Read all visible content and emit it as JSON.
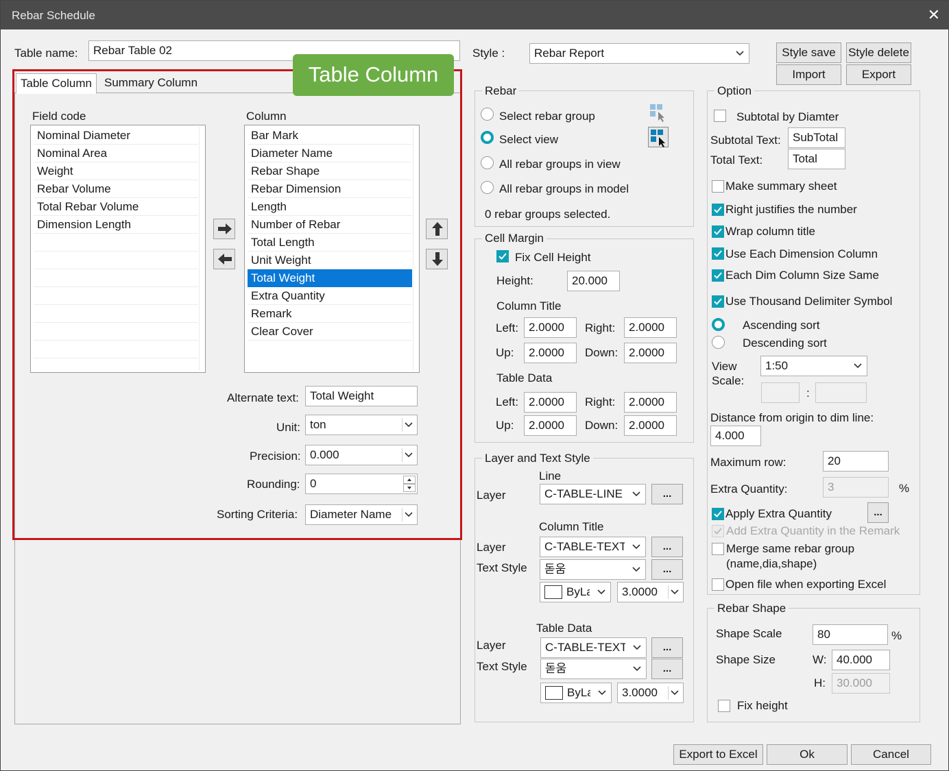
{
  "window": {
    "title": "Rebar Schedule"
  },
  "table_name": {
    "label": "Table name:",
    "value": "Rebar Table 02"
  },
  "callout": "Table Column",
  "tabs": [
    "Table Column",
    "Summary Column"
  ],
  "field_code": {
    "label": "Field code",
    "items": [
      "Nominal Diameter",
      "Nominal Area",
      "Weight",
      "Rebar Volume",
      "Total Rebar Volume",
      "Dimension Length"
    ]
  },
  "column": {
    "label": "Column",
    "items": [
      "Bar Mark",
      "Diameter Name",
      "Rebar Shape",
      "Rebar Dimension",
      "Length",
      "Number of Rebar",
      "Total Length",
      "Unit Weight",
      "Total Weight",
      "Extra Quantity",
      "Remark",
      "Clear Cover"
    ],
    "selected": "Total Weight"
  },
  "props": {
    "alternate_label": "Alternate text:",
    "alternate_value": "Total Weight",
    "unit_label": "Unit:",
    "unit_value": "ton",
    "precision_label": "Precision:",
    "precision_value": "0.000",
    "rounding_label": "Rounding:",
    "rounding_value": "0",
    "sorting_label": "Sorting Criteria:",
    "sorting_value": "Diameter Name"
  },
  "style": {
    "label": "Style :",
    "value": "Rebar Report",
    "save": "Style save",
    "delete": "Style delete",
    "import": "Import",
    "export": "Export"
  },
  "rebar": {
    "title": "Rebar",
    "options": [
      "Select rebar group",
      "Select view",
      "All rebar groups in view",
      "All rebar groups in model"
    ],
    "selected": "Select view",
    "status": "0 rebar groups selected."
  },
  "cell_margin": {
    "title": "Cell Margin",
    "fix_cell_height": "Fix Cell Height",
    "height_label": "Height:",
    "height_value": "20.000",
    "column_title": "Column Title",
    "table_data": "Table Data",
    "left": "Left:",
    "right": "Right:",
    "up": "Up:",
    "down": "Down:",
    "ct": {
      "left": "2.0000",
      "right": "2.0000",
      "up": "2.0000",
      "down": "2.0000"
    },
    "td": {
      "left": "2.0000",
      "right": "2.0000",
      "up": "2.0000",
      "down": "2.0000"
    }
  },
  "layer_text": {
    "title": "Layer and Text Style",
    "line_label": "Line",
    "layer_label": "Layer",
    "text_style_label": "Text Style",
    "line_layer": "C-TABLE-LINE",
    "column_title_label": "Column Title",
    "ct_layer": "C-TABLE-TEXT",
    "ct_style": "돋움",
    "ct_color": "ByLayer",
    "ct_height": "3.0000",
    "table_data_label": "Table Data",
    "td_layer": "C-TABLE-TEXT",
    "td_style": "돋움",
    "td_color": "ByLayer",
    "td_height": "3.0000",
    "more": "..."
  },
  "option": {
    "title": "Option",
    "subtotal_by_diameter": "Subtotal by Diamter",
    "subtotal_text_label": "Subtotal Text:",
    "subtotal_text": "SubTotal",
    "total_text_label": "Total Text:",
    "total_text": "Total",
    "make_summary": "Make summary sheet",
    "right_justifies": "Right justifies the number",
    "wrap_title": "Wrap column title",
    "use_each_dim": "Use Each Dimension Column",
    "each_dim_same": "Each Dim Column Size Same",
    "thousand_delim": "Use Thousand Delimiter Symbol",
    "ascending": "Ascending sort",
    "descending": "Descending sort",
    "view_scale_label_1": "View",
    "view_scale_label_2": "Scale:",
    "view_scale": "1:50",
    "scale_sep": ":",
    "distance_label": "Distance from origin to dim line:",
    "distance_value": "4.000",
    "max_row_label": "Maximum row:",
    "max_row": "20",
    "extra_qty_label": "Extra Quantity:",
    "extra_qty": "3",
    "percent": "%",
    "apply_extra": "Apply Extra Quantity",
    "add_extra_remark": "Add Extra Quantity in the Remark",
    "merge_same_1": "Merge same rebar group",
    "merge_same_2": "(name,dia,shape)",
    "open_file": "Open file when exporting Excel"
  },
  "rebar_shape": {
    "title": "Rebar Shape",
    "scale_label": "Shape Scale",
    "scale_value": "80",
    "percent": "%",
    "size_label": "Shape Size",
    "w_label": "W:",
    "w_value": "40.000",
    "h_label": "H:",
    "h_value": "30.000",
    "fix_height": "Fix height"
  },
  "footer": {
    "export_excel": "Export to Excel",
    "ok": "Ok",
    "cancel": "Cancel"
  },
  "colors": {
    "accent": "#0f9fb5",
    "selection": "#0a78d7",
    "highlight_border": "#c4161c",
    "callout": "#6cae45",
    "titlebar": "#4b4b4b"
  }
}
